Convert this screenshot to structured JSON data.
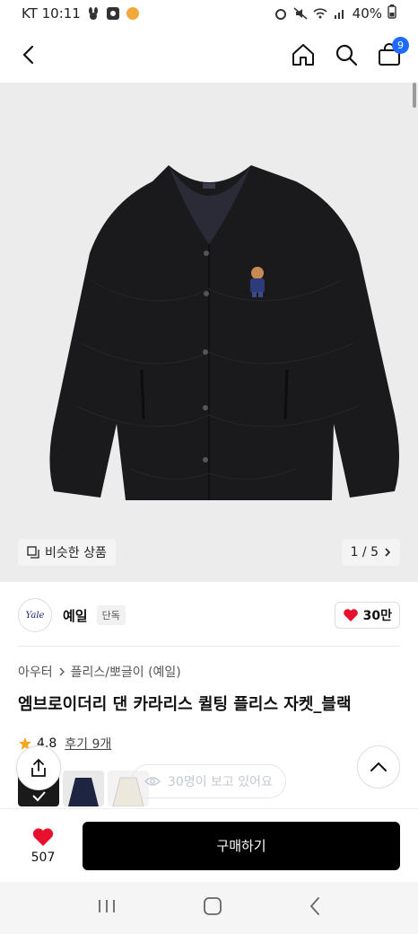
{
  "status_bar": {
    "carrier_time": "KT 10:11",
    "battery": "40%"
  },
  "header": {
    "cart_count": "9"
  },
  "product": {
    "similar_label": "비슷한 상품",
    "page_indicator": "1 / 5",
    "brand": {
      "logo_text": "Yale",
      "name": "예일",
      "tag": "단독",
      "likes": "30만"
    },
    "breadcrumb": {
      "cat1": "아우터",
      "cat2": "플리스/뽀글이 (예일)"
    },
    "title": "엠브로이더리 댄 카라리스 퀼팅 플리스 자켓_블랙",
    "rating": "4.8",
    "reviews": "후기 9개",
    "viewers": "30명이 보고 있어요"
  },
  "action_bar": {
    "wish_count": "507",
    "buy_label": "구매하기"
  },
  "colors": {
    "accent_blue": "#1e6bff",
    "heart_red": "#e8112d",
    "star": "#f5a623"
  }
}
